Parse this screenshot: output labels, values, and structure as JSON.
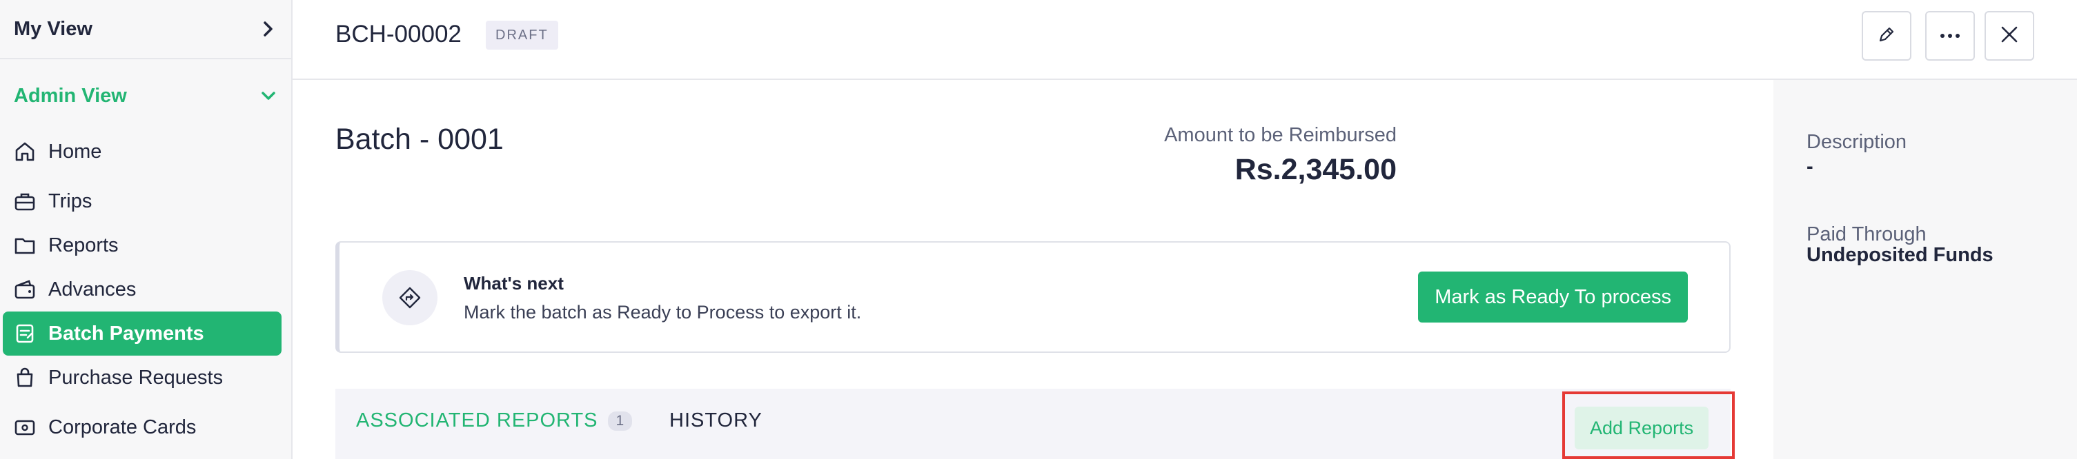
{
  "sidebar": {
    "my_view": "My View",
    "admin_view": "Admin View",
    "items": [
      {
        "label": "Home",
        "icon": "home-icon"
      },
      {
        "label": "Trips",
        "icon": "briefcase-icon"
      },
      {
        "label": "Reports",
        "icon": "folder-icon"
      },
      {
        "label": "Advances",
        "icon": "wallet-icon"
      },
      {
        "label": "Batch Payments",
        "icon": "batch-payment-icon",
        "active": true
      },
      {
        "label": "Purchase Requests",
        "icon": "bag-icon"
      },
      {
        "label": "Corporate Cards",
        "icon": "card-icon"
      }
    ]
  },
  "header": {
    "doc_id": "BCH-00002",
    "status_badge": "DRAFT",
    "actions": [
      "edit-icon",
      "more-icon",
      "close-icon"
    ]
  },
  "main": {
    "batch_title": "Batch - 0001",
    "amount_label": "Amount to be Reimbursed",
    "amount_value": "Rs.2,345.00",
    "next": {
      "title": "What's next",
      "description": "Mark the batch as Ready to Process to export it.",
      "button": "Mark as Ready To process"
    },
    "tabs": [
      {
        "label": "ASSOCIATED REPORTS",
        "count": "1"
      },
      {
        "label": "HISTORY"
      }
    ],
    "add_reports": "Add Reports"
  },
  "details": {
    "description_label": "Description",
    "description_value": "-",
    "paid_through_label": "Paid Through",
    "paid_through_value": "Undeposited Funds"
  },
  "colors": {
    "accent": "#22b573",
    "highlight": "#e53935"
  }
}
